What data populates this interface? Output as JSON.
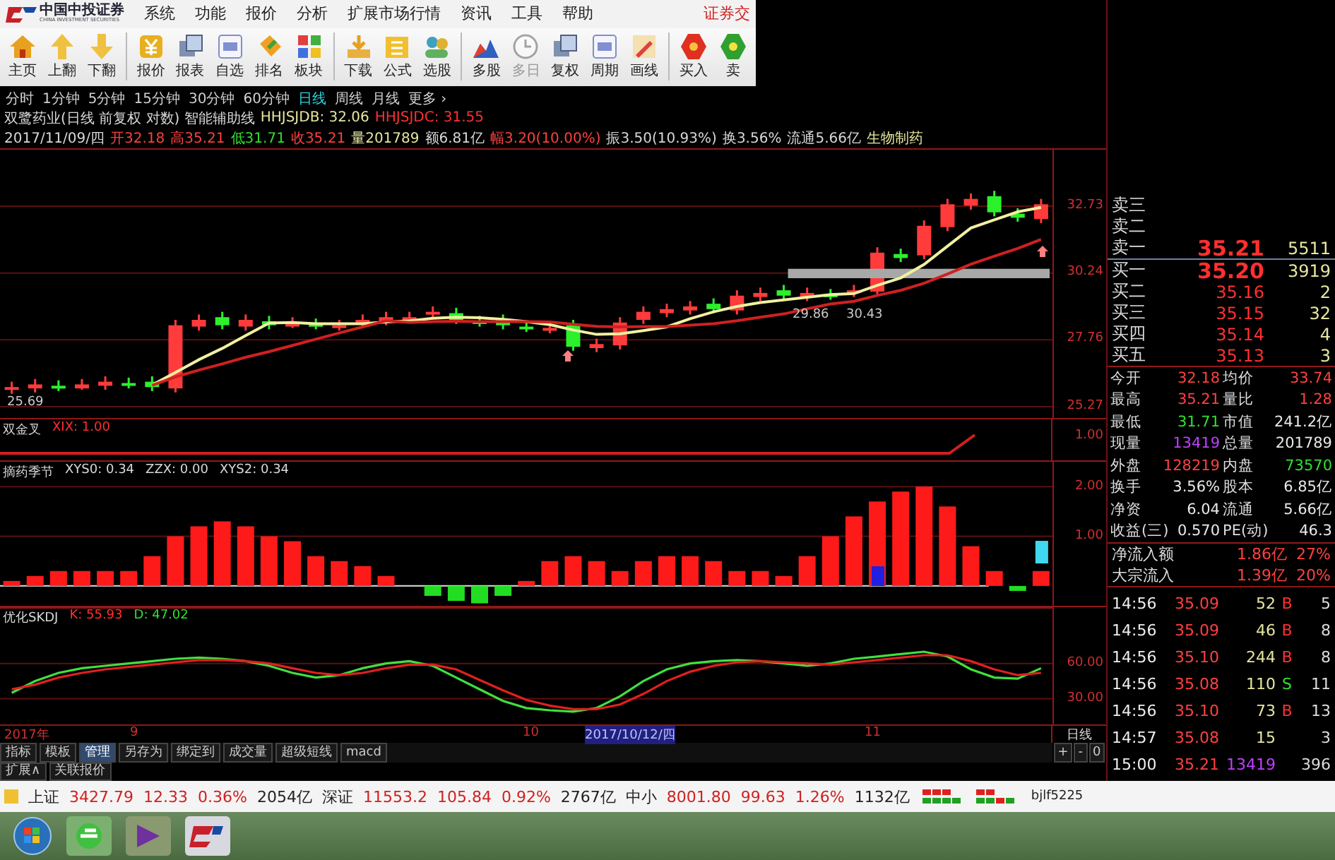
{
  "app": {
    "logo": "中国中投证券",
    "logo_sub": "CHINA INVESTMENT SECURITIES",
    "menu_right": "证券交"
  },
  "menu": [
    "系统",
    "功能",
    "报价",
    "分析",
    "扩展市场行情",
    "资讯",
    "工具",
    "帮助"
  ],
  "toolbar_groups": [
    [
      {
        "label": "主页",
        "kind": "house",
        "disabled": false
      },
      {
        "label": "上翻",
        "kind": "up",
        "disabled": false
      },
      {
        "label": "下翻",
        "kind": "down",
        "disabled": false
      }
    ],
    [
      {
        "label": "报价",
        "kind": "coin",
        "disabled": false
      },
      {
        "label": "报表",
        "kind": "windows",
        "disabled": false
      },
      {
        "label": "自选",
        "kind": "keycap",
        "disabled": false
      },
      {
        "label": "排名",
        "kind": "tag",
        "disabled": false
      },
      {
        "label": "板块",
        "kind": "tiles",
        "disabled": false
      }
    ],
    [
      {
        "label": "下载",
        "kind": "tray",
        "disabled": false
      },
      {
        "label": "公式",
        "kind": "folder",
        "disabled": false
      },
      {
        "label": "选股",
        "kind": "people",
        "disabled": false
      }
    ],
    [
      {
        "label": "多股",
        "kind": "mountain",
        "disabled": false
      },
      {
        "label": "多日",
        "kind": "clock",
        "disabled": true
      },
      {
        "label": "复权",
        "kind": "windows",
        "disabled": false
      },
      {
        "label": "周期",
        "kind": "keycap",
        "disabled": false
      },
      {
        "label": "画线",
        "kind": "pencil",
        "disabled": false
      }
    ],
    [
      {
        "label": "买入",
        "kind": "buy",
        "disabled": false
      },
      {
        "label": "卖",
        "kind": "sell",
        "disabled": false
      }
    ]
  ],
  "periods": [
    {
      "label": "分时",
      "selected": false
    },
    {
      "label": "1分钟",
      "selected": false
    },
    {
      "label": "5分钟",
      "selected": false
    },
    {
      "label": "15分钟",
      "selected": false
    },
    {
      "label": "30分钟",
      "selected": false
    },
    {
      "label": "60分钟",
      "selected": false
    },
    {
      "label": "日线",
      "selected": true
    },
    {
      "label": "周线",
      "selected": false
    },
    {
      "label": "月线",
      "selected": false
    },
    {
      "label": "更多 ›",
      "selected": false
    }
  ],
  "title_line": [
    {
      "text": "双鹭药业(日线 前复权 对数) 智能辅助线",
      "color": "#d8d8d8"
    },
    {
      "text": "HHJSJDB: 32.06",
      "color": "#e6e6a0"
    },
    {
      "text": "HHJSJDC: 31.55",
      "color": "#ff3030"
    }
  ],
  "quote_line": [
    {
      "text": "2017/11/09/四",
      "color": "#d8d8d8"
    },
    {
      "text": "开32.18",
      "color": "#ff4040"
    },
    {
      "text": "高35.21",
      "color": "#ff4040"
    },
    {
      "text": "低31.71",
      "color": "#30e030"
    },
    {
      "text": "收35.21",
      "color": "#ff4040"
    },
    {
      "text": "量201789",
      "color": "#e6e6a0"
    },
    {
      "text": "额6.81亿",
      "color": "#d8d8d8"
    },
    {
      "text": "幅3.20(10.00%)",
      "color": "#ff4040"
    },
    {
      "text": "振3.50(10.93%)",
      "color": "#d8d8d8"
    },
    {
      "text": "换3.56%",
      "color": "#d8d8d8"
    },
    {
      "text": "流通5.66亿",
      "color": "#d8d8d8"
    },
    {
      "text": "生物制药",
      "color": "#e6e6a0"
    }
  ],
  "main_chart": {
    "labels": [
      "29.86",
      "30.43"
    ],
    "low_label": "25.69",
    "chart_data": {
      "type": "candlestick",
      "grid": true,
      "ylim": [
        24.85,
        34.83
      ],
      "yticks": [
        {
          "value": 32.73,
          "label": "32.73"
        },
        {
          "value": 30.24,
          "label": "30.24"
        },
        {
          "value": 27.76,
          "label": "27.76"
        },
        {
          "value": 25.27,
          "label": "25.27"
        }
      ],
      "ohlc": [
        [
          25.9,
          26.2,
          25.75,
          26.0
        ],
        [
          25.95,
          26.3,
          25.8,
          26.1
        ],
        [
          26.05,
          26.25,
          25.85,
          26.0
        ],
        [
          25.95,
          26.3,
          25.9,
          26.1
        ],
        [
          26.05,
          26.4,
          25.9,
          26.2
        ],
        [
          26.15,
          26.35,
          25.95,
          26.1
        ],
        [
          26.2,
          26.4,
          25.85,
          26.0
        ],
        [
          25.95,
          28.5,
          25.8,
          28.3
        ],
        [
          28.25,
          28.7,
          28.1,
          28.5
        ],
        [
          28.6,
          28.8,
          28.15,
          28.3
        ],
        [
          28.25,
          28.7,
          28.1,
          28.5
        ],
        [
          28.45,
          28.65,
          28.15,
          28.3
        ],
        [
          28.25,
          28.6,
          28.2,
          28.4
        ],
        [
          28.35,
          28.55,
          28.15,
          28.3
        ],
        [
          28.25,
          28.5,
          28.1,
          28.3
        ],
        [
          28.4,
          28.7,
          28.25,
          28.5
        ],
        [
          28.45,
          28.8,
          28.3,
          28.6
        ],
        [
          28.55,
          28.8,
          28.4,
          28.6
        ],
        [
          28.7,
          29.0,
          28.55,
          28.8
        ],
        [
          28.75,
          28.95,
          28.35,
          28.5
        ],
        [
          28.45,
          28.65,
          28.25,
          28.4
        ],
        [
          28.5,
          28.7,
          28.15,
          28.3
        ],
        [
          28.25,
          28.45,
          28.05,
          28.2
        ],
        [
          28.15,
          28.4,
          28.0,
          28.2
        ],
        [
          28.3,
          28.5,
          27.35,
          27.5
        ],
        [
          27.45,
          27.8,
          27.3,
          27.6
        ],
        [
          27.55,
          28.6,
          27.4,
          28.4
        ],
        [
          28.5,
          29.0,
          28.35,
          28.8
        ],
        [
          28.75,
          29.1,
          28.6,
          28.9
        ],
        [
          28.85,
          29.2,
          28.7,
          29.0
        ],
        [
          29.1,
          29.3,
          28.75,
          28.9
        ],
        [
          28.85,
          29.6,
          28.7,
          29.4
        ],
        [
          29.35,
          29.7,
          29.2,
          29.5
        ],
        [
          29.6,
          29.8,
          29.25,
          29.4
        ],
        [
          29.35,
          29.7,
          29.2,
          29.5
        ],
        [
          29.45,
          29.65,
          29.25,
          29.4
        ],
        [
          29.5,
          29.8,
          29.35,
          29.6
        ],
        [
          29.55,
          31.2,
          29.4,
          31.0
        ],
        [
          30.95,
          31.15,
          30.65,
          30.8
        ],
        [
          30.9,
          32.2,
          30.75,
          32.0
        ],
        [
          31.95,
          33.0,
          31.8,
          32.8
        ],
        [
          32.75,
          33.2,
          32.6,
          33.0
        ],
        [
          33.1,
          33.3,
          32.35,
          32.5
        ],
        [
          32.45,
          32.65,
          32.15,
          32.3
        ],
        [
          32.25,
          33.0,
          32.1,
          32.8
        ]
      ],
      "bands": [
        {
          "axis": "y",
          "from": 30.05,
          "to": 30.4,
          "color": "#a8a8a8"
        }
      ],
      "series": [
        {
          "type": "line",
          "color": "#f0f0a0",
          "values": [
            null,
            null,
            null,
            null,
            null,
            null,
            26.08,
            26.54,
            27.02,
            27.44,
            27.92,
            28.38,
            28.4,
            28.36,
            28.36,
            28.36,
            28.42,
            28.46,
            28.56,
            28.6,
            28.58,
            28.52,
            28.44,
            28.32,
            28.12,
            27.96,
            27.98,
            28.1,
            28.24,
            28.54,
            28.8,
            29.0,
            29.14,
            29.24,
            29.34,
            29.44,
            29.48,
            29.78,
            30.06,
            30.56,
            31.24,
            31.92,
            32.22,
            32.52,
            32.68
          ]
        },
        {
          "type": "line",
          "color": "#d02020",
          "values": [
            null,
            null,
            null,
            null,
            null,
            null,
            26.07,
            26.38,
            26.63,
            26.86,
            27.11,
            27.32,
            27.55,
            27.78,
            28.01,
            28.24,
            28.47,
            28.4,
            28.43,
            28.45,
            28.44,
            28.44,
            28.43,
            28.42,
            28.34,
            28.26,
            28.24,
            28.25,
            28.25,
            28.3,
            28.36,
            28.47,
            28.6,
            28.72,
            28.91,
            29.09,
            29.19,
            29.41,
            29.6,
            29.86,
            30.2,
            30.57,
            30.87,
            31.16,
            31.49
          ]
        }
      ]
    }
  },
  "cross_panel": {
    "legend": [
      {
        "text": "双金叉",
        "color": "#d8d8d8"
      },
      {
        "text": "XIX: 1.00",
        "color": "#ff3030"
      }
    ],
    "ticks": [
      "1.00"
    ]
  },
  "season_panel": {
    "legend": [
      {
        "text": "摘药季节",
        "color": "#d8d8d8"
      },
      {
        "text": "XYS0: 0.34",
        "color": "#d8d8d8"
      },
      {
        "text": "ZZX: 0.00",
        "color": "#d8d8d8"
      },
      {
        "text": "XYS2: 0.34",
        "color": "#d8d8d8"
      }
    ],
    "chart_data": {
      "type": "bar",
      "ylim": [
        -0.4,
        2.5
      ],
      "yticks": [
        {
          "value": 2,
          "label": "2.00"
        },
        {
          "value": 1,
          "label": "1.00"
        }
      ],
      "series": [
        {
          "color": "#ff1a1a",
          "values": [
            0.1,
            0.2,
            0.3,
            0.3,
            0.3,
            0.3,
            0.6,
            1.0,
            1.2,
            1.3,
            1.2,
            1.0,
            0.9,
            0.6,
            0.5,
            0.4,
            0.2,
            null,
            null,
            null,
            null,
            null,
            0.1,
            0.5,
            0.6,
            0.5,
            0.3,
            0.5,
            0.6,
            0.6,
            0.5,
            0.3,
            0.3,
            0.2,
            0.6,
            1.0,
            1.4,
            1.7,
            1.9,
            2.0,
            1.6,
            0.8,
            0.3,
            null,
            0.3
          ]
        },
        {
          "color": "#22dd22",
          "values": [
            null,
            null,
            null,
            null,
            null,
            null,
            null,
            null,
            null,
            null,
            null,
            null,
            null,
            null,
            null,
            null,
            null,
            null,
            -0.2,
            -0.3,
            -0.35,
            -0.2,
            null,
            null,
            null,
            null,
            null,
            null,
            null,
            null,
            null,
            null,
            null,
            null,
            null,
            null,
            null,
            null,
            null,
            null,
            null,
            null,
            null,
            -0.1,
            null
          ]
        }
      ]
    }
  },
  "skdj_panel": {
    "legend": [
      {
        "text": "优化SKDJ",
        "color": "#d8d8d8"
      },
      {
        "text": "K: 55.93",
        "color": "#ff3030"
      },
      {
        "text": "D: 47.02",
        "color": "#30e030"
      }
    ],
    "chart_data": {
      "type": "line",
      "ylim": [
        8,
        108
      ],
      "yticks": [
        {
          "value": 60,
          "label": "60.00"
        },
        {
          "value": 30,
          "label": "30.00"
        }
      ],
      "series": [
        {
          "color": "#40e040",
          "values": [
            35,
            45,
            52,
            56,
            58,
            60,
            62,
            64,
            65,
            64,
            62,
            58,
            52,
            48,
            50,
            56,
            60,
            62,
            58,
            48,
            38,
            28,
            22,
            20,
            19,
            22,
            32,
            45,
            55,
            60,
            62,
            63,
            62,
            60,
            58,
            60,
            64,
            66,
            68,
            70,
            66,
            55,
            48,
            47,
            56
          ]
        },
        {
          "color": "#e02020",
          "values": [
            38,
            42,
            48,
            52,
            55,
            57,
            59,
            61,
            63,
            63,
            62,
            60,
            56,
            52,
            50,
            52,
            56,
            59,
            59,
            55,
            46,
            37,
            29,
            24,
            21,
            21,
            25,
            34,
            45,
            53,
            58,
            61,
            62,
            61,
            60,
            59,
            61,
            63,
            65,
            67,
            67,
            62,
            55,
            50,
            52
          ]
        }
      ]
    }
  },
  "dates": [
    {
      "text": "2017年",
      "selected": false
    },
    {
      "text": "9",
      "selected": false
    },
    {
      "text": "10",
      "selected": false
    },
    {
      "text": "2017/10/12/四",
      "selected": true
    },
    {
      "text": "11",
      "selected": false
    }
  ],
  "period_label": "日线",
  "zoom_controls": [
    "+",
    "-",
    "0"
  ],
  "bottom_tabs": [
    {
      "label": "指标",
      "selected": false
    },
    {
      "label": "模板",
      "selected": false
    },
    {
      "label": "管理",
      "selected": true
    },
    {
      "label": "另存为",
      "selected": false
    },
    {
      "label": "绑定到",
      "selected": false
    },
    {
      "label": "成交量",
      "selected": false
    },
    {
      "label": "超级短线",
      "selected": false
    },
    {
      "label": "macd",
      "selected": false
    }
  ],
  "bottom_tabs2": [
    "扩展∧",
    "关联报价"
  ],
  "asks": [
    {
      "label": "卖三"
    },
    {
      "label": "卖二"
    },
    {
      "label": "卖一",
      "price": "35.21",
      "vol": "5511"
    }
  ],
  "bids": [
    {
      "label": "买一",
      "price": "35.20",
      "vol": "3919"
    },
    {
      "label": "买二",
      "price": "35.16",
      "vol": "2"
    },
    {
      "label": "买三",
      "price": "35.15",
      "vol": "32"
    },
    {
      "label": "买四",
      "price": "35.14",
      "vol": "4"
    },
    {
      "label": "买五",
      "price": "35.13",
      "vol": "3"
    }
  ],
  "stats": [
    [
      {
        "label": "今开",
        "value": "32.18",
        "color": "#ff4040"
      },
      {
        "label": "均价",
        "value": "33.74",
        "color": "#ff4040"
      }
    ],
    [
      {
        "label": "最高",
        "value": "35.21",
        "color": "#ff4040"
      },
      {
        "label": "量比",
        "value": "1.28",
        "color": "#ff4040"
      }
    ],
    [
      {
        "label": "最低",
        "value": "31.71",
        "color": "#30e030"
      },
      {
        "label": "市值",
        "value": "241.2亿",
        "color": "#e8e8e8"
      }
    ],
    [
      {
        "label": "现量",
        "value": "13419",
        "color": "#c040ff"
      },
      {
        "label": "总量",
        "value": "201789",
        "color": "#e8e8e8"
      }
    ],
    [
      {
        "label": "外盘",
        "value": "128219",
        "color": "#ff4040"
      },
      {
        "label": "内盘",
        "value": "73570",
        "color": "#30e030"
      }
    ],
    [
      {
        "label": "换手",
        "value": "3.56%",
        "color": "#e8e8e8"
      },
      {
        "label": "股本",
        "value": "6.85亿",
        "color": "#e8e8e8"
      }
    ],
    [
      {
        "label": "净资",
        "value": "6.04",
        "color": "#e8e8e8"
      },
      {
        "label": "流通",
        "value": "5.66亿",
        "color": "#e8e8e8"
      }
    ],
    [
      {
        "label": "收益(三)",
        "value": "0.570",
        "color": "#e8e8e8"
      },
      {
        "label": "PE(动)",
        "value": "46.3",
        "color": "#e8e8e8"
      }
    ]
  ],
  "flows": [
    {
      "label": "净流入额",
      "amount": "1.86亿",
      "pct": "27%"
    },
    {
      "label": "大宗流入",
      "amount": "1.39亿",
      "pct": "20%"
    }
  ],
  "trades": [
    {
      "time": "14:56",
      "price": "35.09",
      "vol": "52",
      "side": "B",
      "kind": "buy",
      "extra": "5",
      "color": "#e6e6a0"
    },
    {
      "time": "14:56",
      "price": "35.09",
      "vol": "46",
      "side": "B",
      "kind": "buy",
      "extra": "8",
      "color": "#e6e6a0"
    },
    {
      "time": "14:56",
      "price": "35.10",
      "vol": "244",
      "side": "B",
      "kind": "buy",
      "extra": "8",
      "color": "#e6e6a0"
    },
    {
      "time": "14:56",
      "price": "35.08",
      "vol": "110",
      "side": "S",
      "kind": "sell",
      "extra": "11",
      "color": "#e6e6a0"
    },
    {
      "time": "14:56",
      "price": "35.10",
      "vol": "73",
      "side": "B",
      "kind": "buy",
      "extra": "13",
      "color": "#e6e6a0"
    },
    {
      "time": "14:57",
      "price": "35.08",
      "vol": "15",
      "kind": "none",
      "extra": "3",
      "color": "#e6e6a0"
    },
    {
      "time": "15:00",
      "price": "35.21",
      "vol": "13419",
      "kind": "none",
      "extra": "396",
      "color": "#c040ff"
    }
  ],
  "status": [
    {
      "name": "上证",
      "value": "3427.79",
      "change": "12.33",
      "pct": "0.36%",
      "amount": "2054亿"
    },
    {
      "name": "深证",
      "value": "11553.2",
      "change": "105.84",
      "pct": "0.92%",
      "amount": "2767亿"
    },
    {
      "name": "中小",
      "value": "8001.80",
      "change": "99.63",
      "pct": "1.26%",
      "amount": "1132亿"
    }
  ],
  "ticker": "bjlf5225"
}
